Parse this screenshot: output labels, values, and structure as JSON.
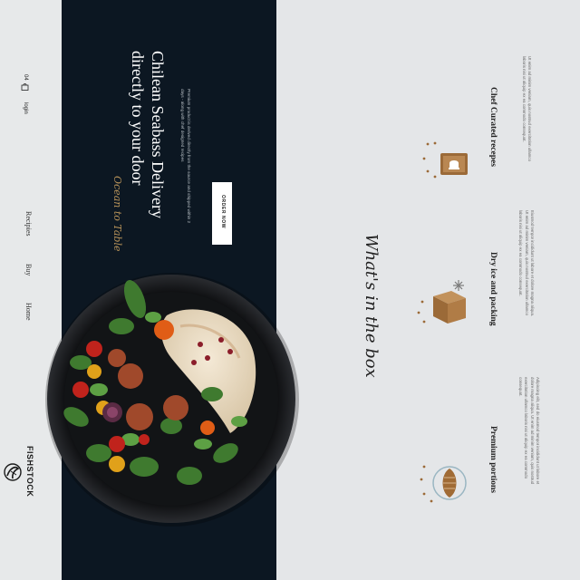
{
  "brand": {
    "name": "FISHSTOCK"
  },
  "nav": {
    "items": [
      {
        "label": "Home"
      },
      {
        "label": "Buy"
      },
      {
        "label": "Recipies"
      }
    ],
    "login_label": "login",
    "cart_count": "04"
  },
  "hero": {
    "script_text": "Ocean to Table",
    "title_line1": "Chilean Seabass Delivery",
    "title_line2": "directly to your door",
    "desc_line1": "Premium product is derived directly from the source and shipped within 2",
    "desc_line2": "days - along with chef designed recipes",
    "cta_label": "ORDER NOW"
  },
  "box_section": {
    "title": "What's in the box",
    "features": [
      {
        "title": "Premium portions",
        "icon": "fish-fillet-icon",
        "desc": [
          "Adipiscing elit, sed do eiusmod tempor incididunt ut labore et",
          "dolore magna aliqua. Ut enim ad minim veniam, quis nostrud",
          "exercitation ullamco laboris nisi ut aliquip ex ea commodo",
          "consequat."
        ]
      },
      {
        "title": "Dry ice and packing",
        "icon": "ice-box-icon",
        "desc": [
          "Eiusmod tempor incididunt ut labore et dolore magna aliqua.",
          "Ut enim ad minim veniam, quis nostrud exercitation ullamco",
          "laboris nisi ut aliquip ex ea commodo consequat."
        ]
      },
      {
        "title": "Chef Curated recepes",
        "icon": "recipe-book-icon",
        "desc": [
          "Ut enim ad minim veniam, quis nostrud exercitation ullamco",
          "laboris nisi ut aliquip ex ea commodo consequat."
        ]
      }
    ]
  },
  "colors": {
    "dark": "#0c1722",
    "accent": "#b8935a",
    "icon_brown": "#9b6a38",
    "background": "#e4e6e8"
  }
}
